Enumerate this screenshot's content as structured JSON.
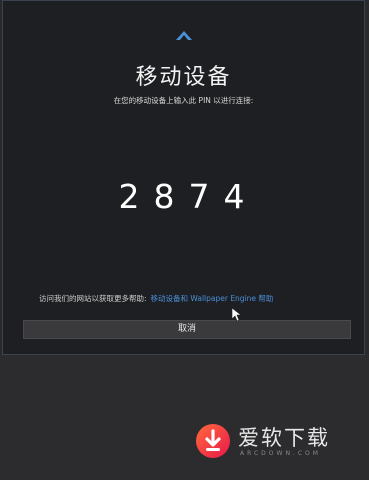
{
  "dialog": {
    "title": "移动设备",
    "subtitle": "在您的移动设备上输入此 PIN 以进行连接:",
    "pin": "2874",
    "help_text": "访问我们的网站以获取更多帮助:",
    "help_link": "移动设备和 Wallpaper Engine 帮助",
    "cancel_label": "取消"
  },
  "icons": {
    "collapse": "chevron-up-icon",
    "cursor": "mouse-cursor-icon"
  },
  "watermark": {
    "brand": "爱软下载",
    "domain": "ARCDOWN.COM"
  },
  "colors": {
    "accent": "#4a90d9",
    "dialog_bg": "#1e1f22",
    "button_bg": "#3a3a3c"
  }
}
